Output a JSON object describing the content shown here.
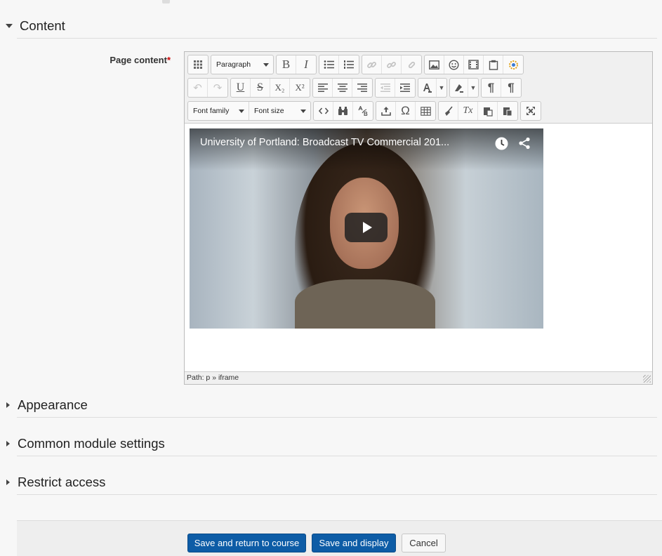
{
  "sections": {
    "content": {
      "title": "Content"
    },
    "appearance": {
      "title": "Appearance"
    },
    "common": {
      "title": "Common module settings"
    },
    "restrict": {
      "title": "Restrict access"
    }
  },
  "field": {
    "label": "Page content",
    "required_mark": "*"
  },
  "toolbar": {
    "paragraph": "Paragraph",
    "font_family": "Font family",
    "font_size": "Font size",
    "icons": {
      "bold": "B",
      "italic": "I",
      "underline": "U",
      "strike": "S",
      "subscript": "X₂",
      "superscript": "X²",
      "omega": "Ω",
      "ltr": "¶",
      "rtl": "¶",
      "clear": "Tx"
    }
  },
  "video": {
    "title": "University of Portland: Broadcast TV Commercial 201...",
    "watch_later_icon": "clock-icon",
    "share_icon": "share-icon"
  },
  "editor": {
    "path": "Path: p » iframe"
  },
  "buttons": {
    "save_return": "Save and return to course",
    "save_display": "Save and display",
    "cancel": "Cancel"
  },
  "colors": {
    "primary": "#0d5ca6",
    "required": "#cc0000"
  }
}
